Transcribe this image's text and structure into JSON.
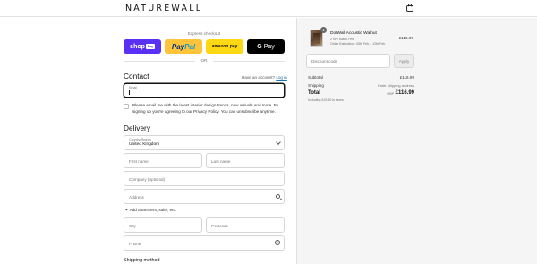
{
  "header": {
    "logo": "NATUREWALL",
    "bag_icon": "shopping-bag-icon"
  },
  "express": {
    "label": "Express checkout",
    "shop_label": "shop",
    "shop_tag": "Pay",
    "paypal_a": "Pay",
    "paypal_b": "Pal",
    "amazon_label": "amazon pay",
    "gpay_g": "G",
    "gpay_label": "Pay",
    "or_label": "OR"
  },
  "contact": {
    "title": "Contact",
    "have_account": "Have an account?",
    "login_link": "Log in",
    "email_label": "Email",
    "email_value": "",
    "newsletter_text": "Please email me with the latest interior design trends, new arrivals and more. By signing up you're agreeing to our Privacy Policy. You can unsubscribe anytime."
  },
  "delivery": {
    "title": "Delivery",
    "country_label": "Country/Region",
    "country_value": "United Kingdom",
    "first_name": "First name",
    "last_name": "Last name",
    "company": "Company (optional)",
    "address": "Address",
    "add_apartment": "Add apartment, suite, etc.",
    "city": "City",
    "postcode": "Postcode",
    "phone": "Phone"
  },
  "shipping": {
    "title": "Shipping method"
  },
  "order": {
    "product_name": "DotWall Acoustic Walnut",
    "product_meta": "2 m² / Black Felt",
    "product_meta2": "Order Estimation: 05th Feb – 12th Feb",
    "quantity": "1",
    "price": "£116.99",
    "discount_placeholder": "Discount code",
    "apply_label": "Apply",
    "subtotal_label": "Subtotal",
    "subtotal_value": "£116.99",
    "shipping_label": "Shipping",
    "shipping_value": "Enter shipping address",
    "total_label": "Total",
    "total_currency": "GBP",
    "total_value": "£116.99",
    "tax_note": "Including £19.50 in taxes"
  },
  "colors": {
    "shop_pay": "#5a31f4",
    "paypal": "#ffc439",
    "amazon_pay": "#ffd814",
    "gpay": "#000000",
    "link": "#1773b0",
    "summary_bg": "#f5f5f5"
  }
}
